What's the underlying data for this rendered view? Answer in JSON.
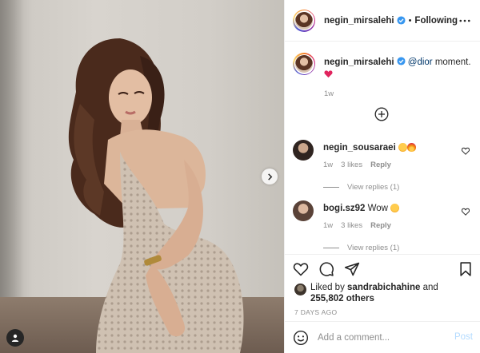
{
  "post": {
    "author": "negin_mirsalehi",
    "follow_status": "Following",
    "separator": "•",
    "caption_mention": "@dior",
    "caption_text": " moment.",
    "caption_time": "1w",
    "icons": {
      "verified": "verified-badge-icon",
      "more": "more-options-icon",
      "next": "chevron-right-icon",
      "tag": "user-tag-icon",
      "load_more": "plus-circle-icon",
      "heart_emoji": "red-heart-emoji"
    }
  },
  "comments": [
    {
      "username": "negin_sousaraei",
      "text": "",
      "emojis": [
        "heart-eyes-emoji",
        "fire-emoji"
      ],
      "time": "1w",
      "likes": "3 likes",
      "reply_label": "Reply",
      "view_replies": "View replies (1)"
    },
    {
      "username": "bogi.sz92",
      "text": "Wow",
      "emojis": [
        "heart-eyes-emoji"
      ],
      "time": "1w",
      "likes": "3 likes",
      "reply_label": "Reply",
      "view_replies": "View replies (1)"
    }
  ],
  "actions": {
    "icons": [
      "heart-icon",
      "comment-icon",
      "share-icon",
      "bookmark-icon"
    ],
    "liked_by_prefix": "Liked by ",
    "liked_by_user": "sandrabichahine",
    "liked_by_and": " and",
    "others_count": "255,802 others",
    "date": "7 DAYS AGO"
  },
  "comment_box": {
    "placeholder": "Add a comment...",
    "post_label": "Post",
    "emoji_icon": "smiley-icon"
  },
  "colors": {
    "text": "#262626",
    "secondary": "#8e8e8e",
    "link": "#00376b",
    "verified": "#3897f0",
    "post_disabled": "#b3dbff",
    "border": "#efefef"
  }
}
